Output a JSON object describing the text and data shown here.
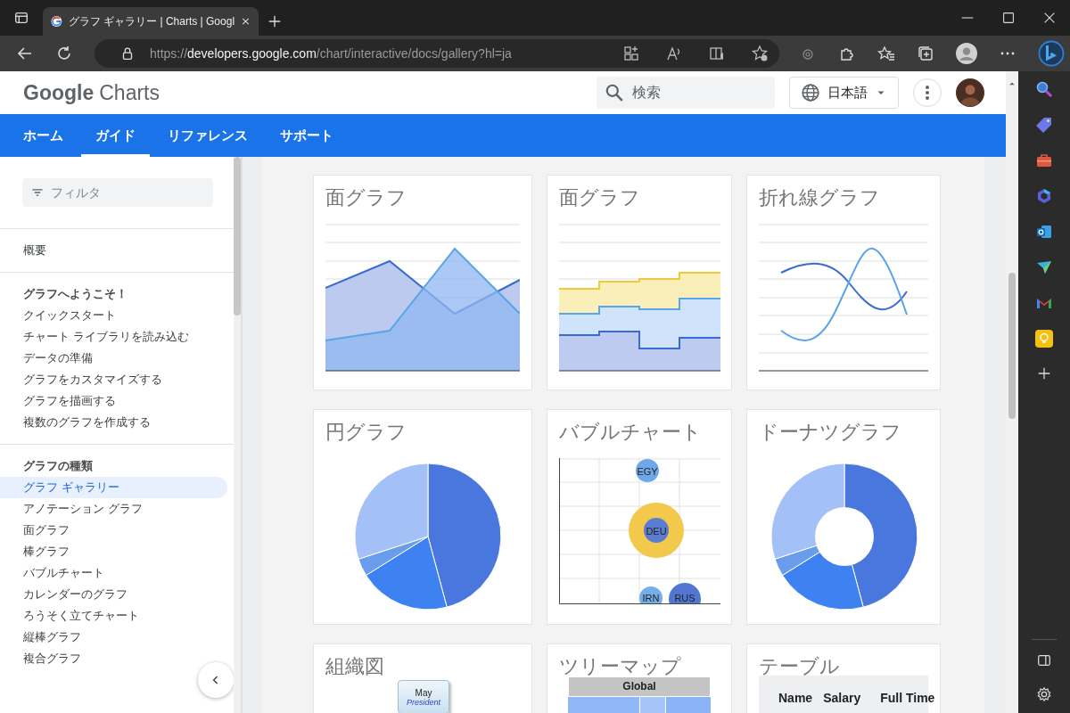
{
  "browser": {
    "tabs": [
      {
        "title": "グラフ ギャラリー | Charts | Googl",
        "selected": true
      }
    ],
    "url": {
      "scheme": "https://",
      "host": "developers.google.com",
      "path": "/chart/interactive/docs/gallery?hl=ja"
    }
  },
  "site": {
    "logo": {
      "brand": "Google",
      "product": "Charts"
    },
    "search": {
      "placeholder": "検索"
    },
    "language": "日本語"
  },
  "nav": [
    {
      "label": "ホーム",
      "selected": false
    },
    {
      "label": "ガイド",
      "selected": true
    },
    {
      "label": "リファレンス",
      "selected": false
    },
    {
      "label": "サポート",
      "selected": false
    }
  ],
  "sidebar": {
    "filter": {
      "placeholder": "フィルタ"
    },
    "sections": [
      {
        "items": [
          {
            "label": "概要",
            "kind": "link",
            "selected": false
          }
        ]
      },
      {
        "items": [
          {
            "label": "グラフへようこそ！",
            "kind": "heading",
            "selected": false
          },
          {
            "label": "クイックスタート",
            "kind": "link",
            "selected": false
          },
          {
            "label": "チャート ライブラリを読み込む",
            "kind": "link",
            "selected": false
          },
          {
            "label": "データの準備",
            "kind": "link",
            "selected": false
          },
          {
            "label": "グラフをカスタマイズする",
            "kind": "link",
            "selected": false
          },
          {
            "label": "グラフを描画する",
            "kind": "link",
            "selected": false
          },
          {
            "label": "複数のグラフを作成する",
            "kind": "link",
            "selected": false
          }
        ]
      },
      {
        "items": [
          {
            "label": "グラフの種類",
            "kind": "heading",
            "selected": false
          },
          {
            "label": "グラフ ギャラリー",
            "kind": "link",
            "selected": true
          },
          {
            "label": "アノテーション グラフ",
            "kind": "link",
            "selected": false
          },
          {
            "label": "面グラフ",
            "kind": "link",
            "selected": false
          },
          {
            "label": "棒グラフ",
            "kind": "link",
            "selected": false
          },
          {
            "label": "バブルチャート",
            "kind": "link",
            "selected": false
          },
          {
            "label": "カレンダーのグラフ",
            "kind": "link",
            "selected": false
          },
          {
            "label": "ろうそく立てチャート",
            "kind": "link",
            "selected": false
          },
          {
            "label": "縦棒グラフ",
            "kind": "link",
            "selected": false
          },
          {
            "label": "複合グラフ",
            "kind": "link",
            "selected": false
          }
        ]
      }
    ]
  },
  "gallery": [
    {
      "title": "面グラフ",
      "kind": "area"
    },
    {
      "title": "面グラフ",
      "kind": "stepped"
    },
    {
      "title": "折れ線グラフ",
      "kind": "line"
    },
    {
      "title": "円グラフ",
      "kind": "pie"
    },
    {
      "title": "バブルチャート",
      "kind": "bubble",
      "labels": [
        "EGY",
        "DEU",
        "IRN",
        "RUS"
      ]
    },
    {
      "title": "ドーナツグラフ",
      "kind": "donut"
    },
    {
      "title": "組織図",
      "kind": "org",
      "node": {
        "name": "May",
        "role": "President"
      }
    },
    {
      "title": "ツリーマップ",
      "kind": "treemap",
      "header": "Global"
    },
    {
      "title": "テーブル",
      "kind": "table",
      "columns": [
        "Name",
        "Salary",
        "Full Time"
      ]
    }
  ]
}
